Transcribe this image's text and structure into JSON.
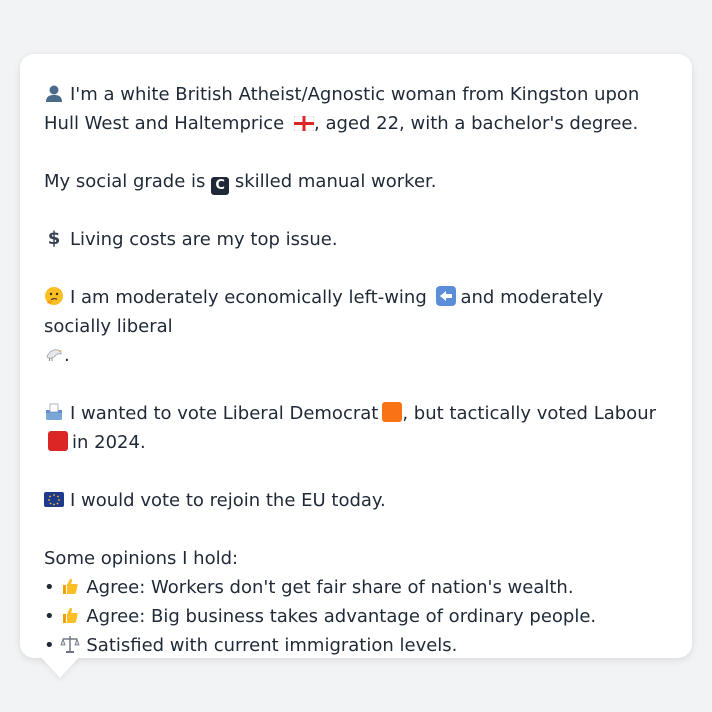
{
  "message": {
    "intro_a": "I'm a white British Atheist/Agnostic woman from Kingston upon Hull West and Haltemprice",
    "intro_b": ", aged 22, with a bachelor's degree.",
    "grade_a": "My social grade is",
    "grade_letter": "C",
    "grade_b": "skilled manual worker.",
    "issue": "Living costs are my top issue.",
    "ideology_a": "I am moderately economically left-wing",
    "ideology_b": "and moderately socially liberal",
    "ideology_c": ".",
    "vote_a": "I wanted to vote Liberal Democrat",
    "vote_b": ", but tactically voted Labour",
    "vote_c": "in 2024.",
    "eu": "I would vote to rejoin the EU today.",
    "opinions_heading": "Some opinions I hold:",
    "opinions": [
      {
        "bullet": "•",
        "icon": "thumbs-up-icon",
        "text": "Agree: Workers don't get fair share of nation's wealth."
      },
      {
        "bullet": "•",
        "icon": "thumbs-up-icon",
        "text": "Agree: Big business takes advantage of ordinary people."
      },
      {
        "bullet": "•",
        "icon": "scales-icon",
        "text": "Satisfied with current immigration levels."
      }
    ]
  },
  "icons": {
    "person": "bust-silhouette-icon",
    "flag": "england-flag-icon",
    "grade": "c-button-icon",
    "dollar": "heavy-dollar-sign-icon",
    "thinking": "thinking-face-icon",
    "left_arrow": "left-arrow-icon",
    "dove": "dove-icon",
    "ballot": "ballot-box-icon",
    "eu": "eu-flag-icon"
  },
  "colors": {
    "background": "#f2f3f5",
    "card": "#ffffff",
    "text": "#1f2937",
    "libdem_orange": "#f97316",
    "labour_red": "#dc2626",
    "eu_blue": "#1e3a8a",
    "eu_gold": "#fbbf24"
  }
}
